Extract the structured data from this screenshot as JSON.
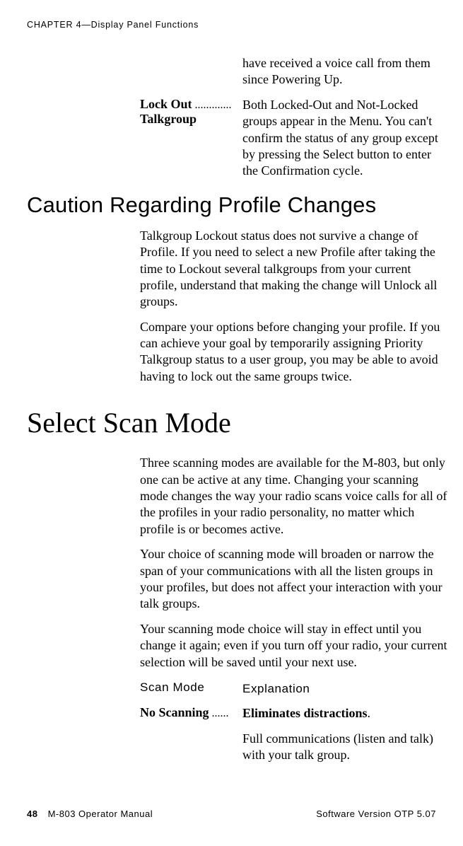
{
  "running_head": "CHAPTER 4—Display Panel Functions",
  "intro_continuation": "have received a voice call from them since Powering Up.",
  "lockout": {
    "label_line1": "Lock Out",
    "label_dots": " .............",
    "label_line2": "Talkgroup",
    "text": "Both Locked-Out and Not-Locked groups appear in the Menu. You can't confirm the status of any group except by pressing the Select button to enter the Confirmation cycle."
  },
  "caution": {
    "heading": "Caution Regarding Profile Changes",
    "p1": "Talkgroup Lockout status does not survive a change of Profile. If you need to select a new Profile after taking the time to Lockout several talkgroups from your current profile, understand that making the change will Unlock all groups.",
    "p2": "Compare your options before changing your profile. If you can achieve your goal by temporarily assigning Priority Talkgroup status to a user group, you may be able to avoid having to lock out the same groups twice."
  },
  "select_scan": {
    "heading": "Select Scan Mode",
    "p1": "Three scanning modes are available for the M-803, but only one can be active at any time. Changing your scanning mode changes the way your radio scans voice calls for all of the profiles in your radio personality, no matter which profile is or becomes active.",
    "p2": "Your choice of scanning mode will broaden or narrow the span of your communications with all the listen groups in your profiles, but does not affect your interaction with your talk groups.",
    "p3": "Your scanning mode choice will stay in effect until you change it again; even if you turn off your radio, your current selection will be saved until your next use.",
    "col_head_left": "Scan Mode",
    "col_head_right": "Explanation",
    "row1_label": "No Scanning",
    "row1_dots": " ......",
    "row1_value_bold": "Eliminates distractions",
    "row1_value_tail": ".",
    "row1_value_p2": "Full communications (listen and talk) with your talk group."
  },
  "footer": {
    "page": "48",
    "left": "M-803 Operator Manual",
    "right": "Software Version OTP 5.07"
  }
}
